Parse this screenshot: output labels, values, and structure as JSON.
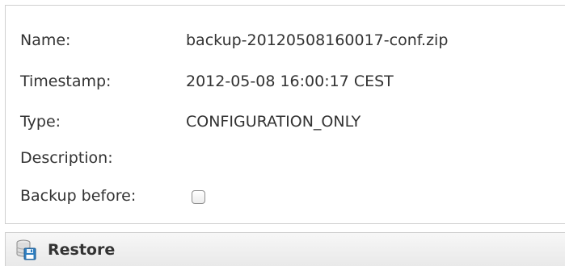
{
  "details": {
    "name_label": "Name:",
    "name_value": "backup-20120508160017-conf.zip",
    "timestamp_label": "Timestamp:",
    "timestamp_value": "2012-05-08 16:00:17 CEST",
    "type_label": "Type:",
    "type_value": "CONFIGURATION_ONLY",
    "description_label": "Description:",
    "description_value": "",
    "backup_before_label": "Backup before:",
    "backup_before_checked": false
  },
  "toolbar": {
    "restore_label": "Restore",
    "restore_icon": "database-restore-icon"
  },
  "colors": {
    "border": "#cfcfcf",
    "text": "#333333",
    "toolbar_top": "#f7f7f7",
    "toolbar_bottom": "#e9e9e9",
    "icon_blue": "#2f7fc1"
  }
}
